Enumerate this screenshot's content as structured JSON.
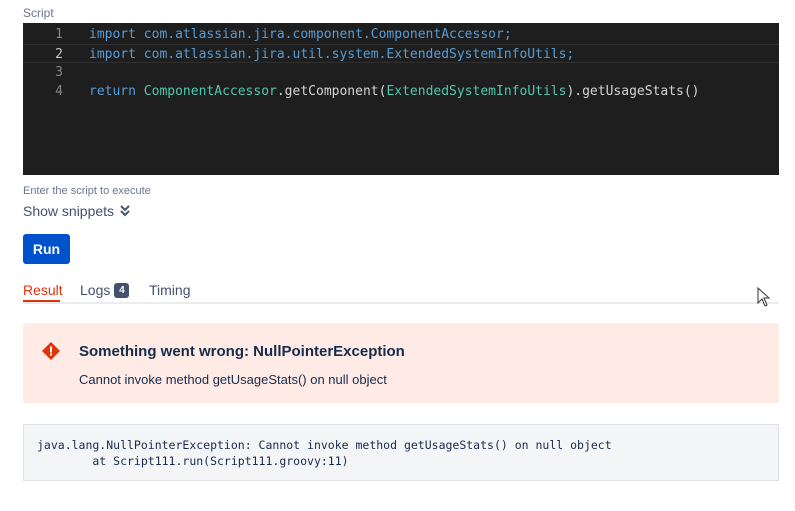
{
  "script_section": {
    "label": "Script",
    "lines": [
      {
        "number": "1",
        "tokens": [
          {
            "text": "import com.atlassian.jira.component.ComponentAccessor;",
            "kind": "kw"
          }
        ]
      },
      {
        "number": "2",
        "tokens": [
          {
            "text": "import com.atlassian.jira.util.system.ExtendedSystemInfoUtils;",
            "kind": "kw"
          }
        ]
      },
      {
        "number": "3",
        "tokens": []
      },
      {
        "number": "4",
        "tokens": [
          {
            "text": "return ",
            "kind": "kw"
          },
          {
            "text": "ComponentAccessor",
            "kind": "cls"
          },
          {
            "text": ".getComponent(",
            "kind": "plain"
          },
          {
            "text": "ExtendedSystemInfoUtils",
            "kind": "cls"
          },
          {
            "text": ").getUsageStats()",
            "kind": "plain"
          }
        ]
      }
    ],
    "helper_text": "Enter the script to execute",
    "show_snippets_label": "Show snippets"
  },
  "run_button_label": "Run",
  "tabs": [
    {
      "label": "Result",
      "selected": true
    },
    {
      "label": "Logs",
      "badge": "4",
      "selected": false
    },
    {
      "label": "Timing",
      "selected": false
    }
  ],
  "error": {
    "title": "Something went wrong: NullPointerException",
    "message": "Cannot invoke method getUsageStats() on null object",
    "icon": "error-icon"
  },
  "stack_trace": [
    "java.lang.NullPointerException: Cannot invoke method getUsageStats() on null object",
    "        at Script111.run(Script111.groovy:11)"
  ],
  "colors": {
    "accent": "#0052cc",
    "error": "#de350b",
    "error_bg": "#ffebe6",
    "editor_bg": "#1e1e1e"
  }
}
